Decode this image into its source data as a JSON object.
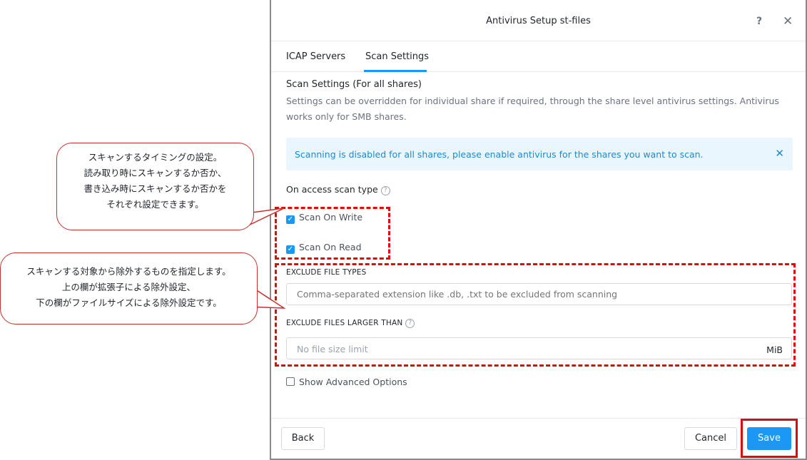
{
  "modal": {
    "title": "Antivirus Setup st-files",
    "help_glyph": "?",
    "close_glyph": "✕",
    "tabs": [
      {
        "label": "ICAP Servers",
        "active": false
      },
      {
        "label": "Scan Settings",
        "active": true
      }
    ],
    "section_title": "Scan Settings (For all shares)",
    "section_desc": "Settings can be overridden for individual share if required, through the share level antivirus settings. Antivirus works only for SMB shares.",
    "banner": {
      "text": "Scanning is disabled for all shares, please enable antivirus for the shares you want to scan.",
      "close_glyph": "✕"
    },
    "scan_type": {
      "label": "On access scan type",
      "options": [
        {
          "label": "Scan On Write",
          "checked": true
        },
        {
          "label": "Scan On Read",
          "checked": true
        }
      ]
    },
    "exclude_types": {
      "label": "EXCLUDE FILE TYPES",
      "value": "",
      "placeholder": "Comma-separated extension like .db, .txt to be excluded from scanning"
    },
    "exclude_size": {
      "label": "EXCLUDE FILES LARGER THAN",
      "value": "",
      "placeholder": "No file size limit",
      "unit": "MiB"
    },
    "advanced": {
      "label": "Show Advanced Options",
      "checked": false
    },
    "footer": {
      "back": "Back",
      "cancel": "Cancel",
      "save": "Save"
    }
  },
  "annotations": {
    "callout_scan_timing": [
      "スキャンするタイミングの設定。",
      "読み取り時にスキャンするか否か、",
      "書き込み時にスキャンするか否かを",
      "それぞれ設定できます。"
    ],
    "callout_exclude": [
      "スキャンする対象から除外するものを指定します。",
      "上の欄が拡張子による除外設定、",
      "下の欄がファイルサイズによる除外設定です。"
    ]
  },
  "colors": {
    "accent": "#1b98f5",
    "banner_bg": "#eaf6fe",
    "annotation_red": "#e10a0a"
  }
}
